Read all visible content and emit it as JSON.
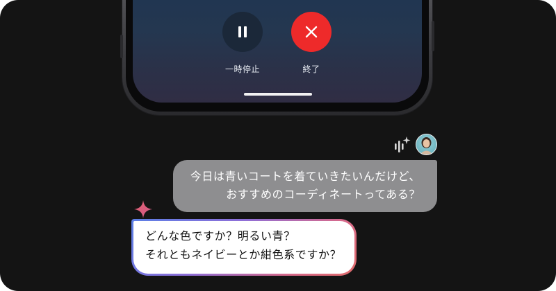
{
  "call_controls": {
    "pause_label": "一時停止",
    "end_label": "終了",
    "pause_icon": "pause-icon",
    "end_icon": "close-icon",
    "end_color": "#ee2a2a"
  },
  "chat": {
    "user_message": {
      "line1": "今日は青いコートを着ていきたいんだけど、",
      "line2": "おすすめのコーディネートってある？"
    },
    "ai_message": {
      "line1": "どんな色ですか？明るい青？",
      "line2": "それともネイビーとか紺色系ですか？"
    },
    "assistant_icon": "voice-sparkle-icon",
    "ai_icon": "sparkle-icon",
    "user_bubble_color": "#8e8e90"
  }
}
